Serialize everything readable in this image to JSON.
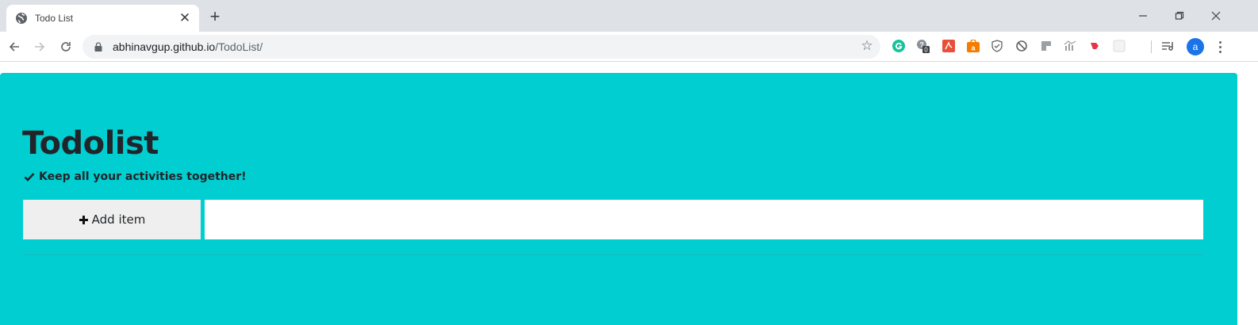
{
  "browser": {
    "tab": {
      "title": "Todo List",
      "favicon": "globe-icon",
      "close_glyph": "✕"
    },
    "new_tab_glyph": "+",
    "window_controls": [
      "minimize-icon",
      "restore-icon",
      "close-icon"
    ],
    "address": {
      "host": "abhinavgup.github.io",
      "path": "/TodoList/"
    },
    "star_glyph": "☆",
    "extensions": [
      "grammarly-icon",
      "extension-badge-icon",
      "pdf-icon",
      "shopping-bag-icon",
      "shield-check-icon",
      "block-icon",
      "puzzle-tile-icon",
      "chart-icon",
      "bookmark-pin-icon",
      "blank-extension-icon"
    ],
    "extension_badge": "0",
    "reading_list_glyph": "≡",
    "profile_initial": "a"
  },
  "app": {
    "title": "Todolist",
    "subtitle": "Keep all your activities together!",
    "add_button_label": "Add item",
    "input_value": "",
    "items": []
  },
  "colors": {
    "page_background": "#00ced1",
    "text": "#212529",
    "button_background": "#efefef",
    "profile": "#1a73e8"
  }
}
